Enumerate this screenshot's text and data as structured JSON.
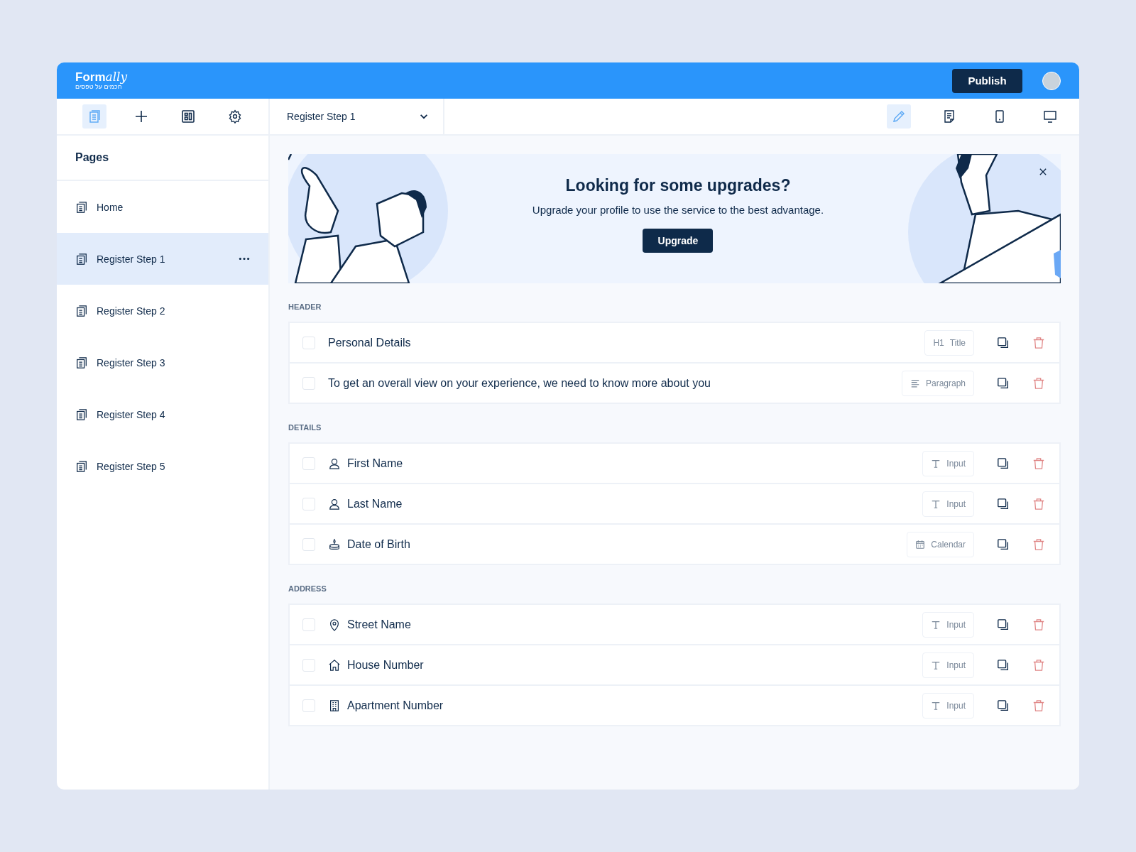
{
  "header": {
    "logo": "Form",
    "logo_script": "ally",
    "tagline": "חכמים על טפסים",
    "publish_button": "Publish"
  },
  "toolbar": {
    "tools": [
      {
        "kind": "pages",
        "selected": true
      },
      {
        "kind": "add",
        "selected": false
      },
      {
        "kind": "layout",
        "selected": false
      },
      {
        "kind": "settings",
        "selected": false
      }
    ],
    "page_select": "Register Step 1",
    "views": [
      {
        "kind": "edit",
        "selected": true
      },
      {
        "kind": "preview",
        "selected": false
      },
      {
        "kind": "mobile",
        "selected": false
      },
      {
        "kind": "desktop",
        "selected": false
      }
    ]
  },
  "sidebar": {
    "title": "Pages",
    "items": [
      {
        "label": "Home",
        "selected": false
      },
      {
        "label": "Register Step 1",
        "selected": true
      },
      {
        "label": "Register Step 2",
        "selected": false
      },
      {
        "label": "Register Step 3",
        "selected": false
      },
      {
        "label": "Register Step 4",
        "selected": false
      },
      {
        "label": "Register Step 5",
        "selected": false
      }
    ]
  },
  "banner": {
    "title": "Looking for some upgrades?",
    "text": "Upgrade your profile to use the service to the best advantage.",
    "button": "Upgrade"
  },
  "sections": [
    {
      "title": "HEADER",
      "rows": [
        {
          "label": "Personal Details",
          "checked": false,
          "kind": "title",
          "type_prefix": "H1",
          "type": "Title"
        },
        {
          "label": "To get an overall view on your experience, we need to know more about you",
          "checked": false,
          "kind": "paragraph",
          "type": "Paragraph"
        }
      ]
    },
    {
      "title": "DETAILS",
      "rows": [
        {
          "label": "First Name",
          "checked": false,
          "kind": "input",
          "type": "Input"
        },
        {
          "label": "Last Name",
          "checked": false,
          "kind": "input",
          "type": "Input"
        },
        {
          "label": "Date of Birth",
          "checked": false,
          "kind": "calendar",
          "type": "Calendar"
        }
      ]
    },
    {
      "title": "ADDRESS",
      "rows": [
        {
          "label": "Street Name",
          "checked": false,
          "kind": "input",
          "type": "Input"
        },
        {
          "label": "House Number",
          "checked": false,
          "kind": "input",
          "type": "Input"
        },
        {
          "label": "Apartment Number",
          "checked": false,
          "kind": "input",
          "type": "Input"
        }
      ]
    }
  ]
}
